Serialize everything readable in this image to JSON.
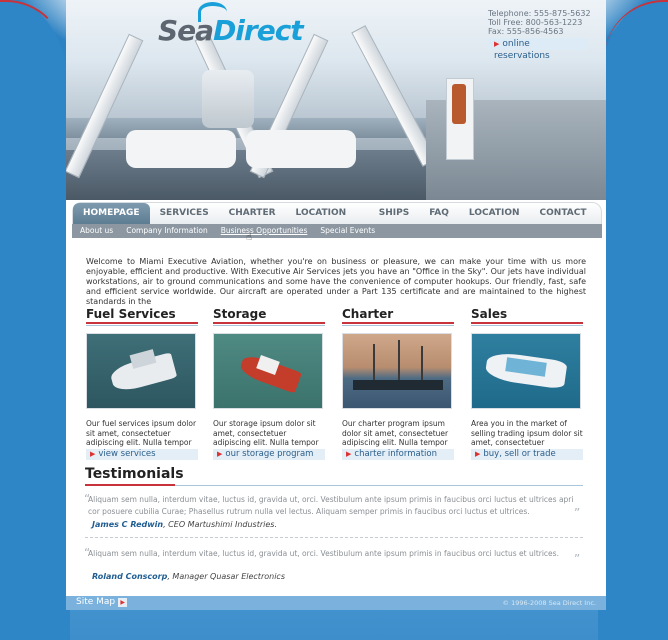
{
  "brand": {
    "logo_part1": "Sea",
    "logo_part2": "Direct"
  },
  "contact": {
    "telephone": "Telephone: 555-875-5632",
    "tollfree": "Toll Free: 800-563-1223",
    "fax": "Fax: 555-856-4563"
  },
  "reservations_label": "online reservations",
  "nav": {
    "items": [
      "HOMEPAGE",
      "SERVICES",
      "CHARTER",
      "LOCATION INFO",
      "SHIPS",
      "FAQ",
      "LOCATION",
      "CONTACT US"
    ],
    "active": "HOMEPAGE"
  },
  "subnav": {
    "items": [
      "About us",
      "Company Information",
      "Business Opportunities",
      "Special Events"
    ],
    "highlighted": "Business Opportunities"
  },
  "intro": "Welcome to Miami Executive Aviation, whether you're on business or pleasure, we can make your time with us more enjoyable, efficient and productive. With Executive Air Services jets you have an \"Office in the Sky\". Our jets have individual workstations, air to ground communications and some have the convenience of computer hookups. Our friendly, fast, safe and efficient service worldwide. Our aircraft are operated under a Part 135 certificate and are maintained to the highest standards in the",
  "columns": [
    {
      "title": "Fuel Services",
      "text": "Our fuel services ipsum dolor sit amet, consectetuer adipiscing elit. Nulla tempor",
      "link": "view services"
    },
    {
      "title": "Storage",
      "text": "Our storage ipsum dolor sit amet, consectetuer adipiscing elit. Nulla tempor ante et sem",
      "link": "our storage program"
    },
    {
      "title": "Charter",
      "text": "Our charter program ipsum dolor sit amet, consectetuer adipiscing elit. Nulla tempor",
      "link": "charter information"
    },
    {
      "title": "Sales",
      "text": "Area you in the market of selling trading ipsum dolor sit amet, consectetuer adipiscing",
      "link": "buy, sell or trade"
    }
  ],
  "testimonials": {
    "heading": "Testimonials",
    "items": [
      {
        "quote": "Aliquam sem nulla, interdum vitae, luctus id, gravida ut, orci. Vestibulum ante ipsum primis in faucibus orci luctus et ultrices apri cor posuere cubilia Curae; Phasellus rutrum nulla vel lectus. Aliquam semper primis in faucibus orci luctus et ultrices.",
        "name": "James C Redwin",
        "role": ", CEO Martushimi Industries."
      },
      {
        "quote": "Aliquam sem nulla, interdum vitae, luctus id, gravida ut, orci. Vestibulum ante ipsum primis in faucibus orci luctus et ultrices.",
        "name": "Roland Conscorp",
        "role": ", Manager Quasar Electronics"
      }
    ]
  },
  "footer": {
    "sitemap": "Site Map",
    "copyright": "© 1996-2008 Sea Direct Inc."
  },
  "colors": {
    "accent_red": "#c8323a",
    "brand_blue": "#1aa0d8",
    "link_blue": "#2b5f8c"
  }
}
